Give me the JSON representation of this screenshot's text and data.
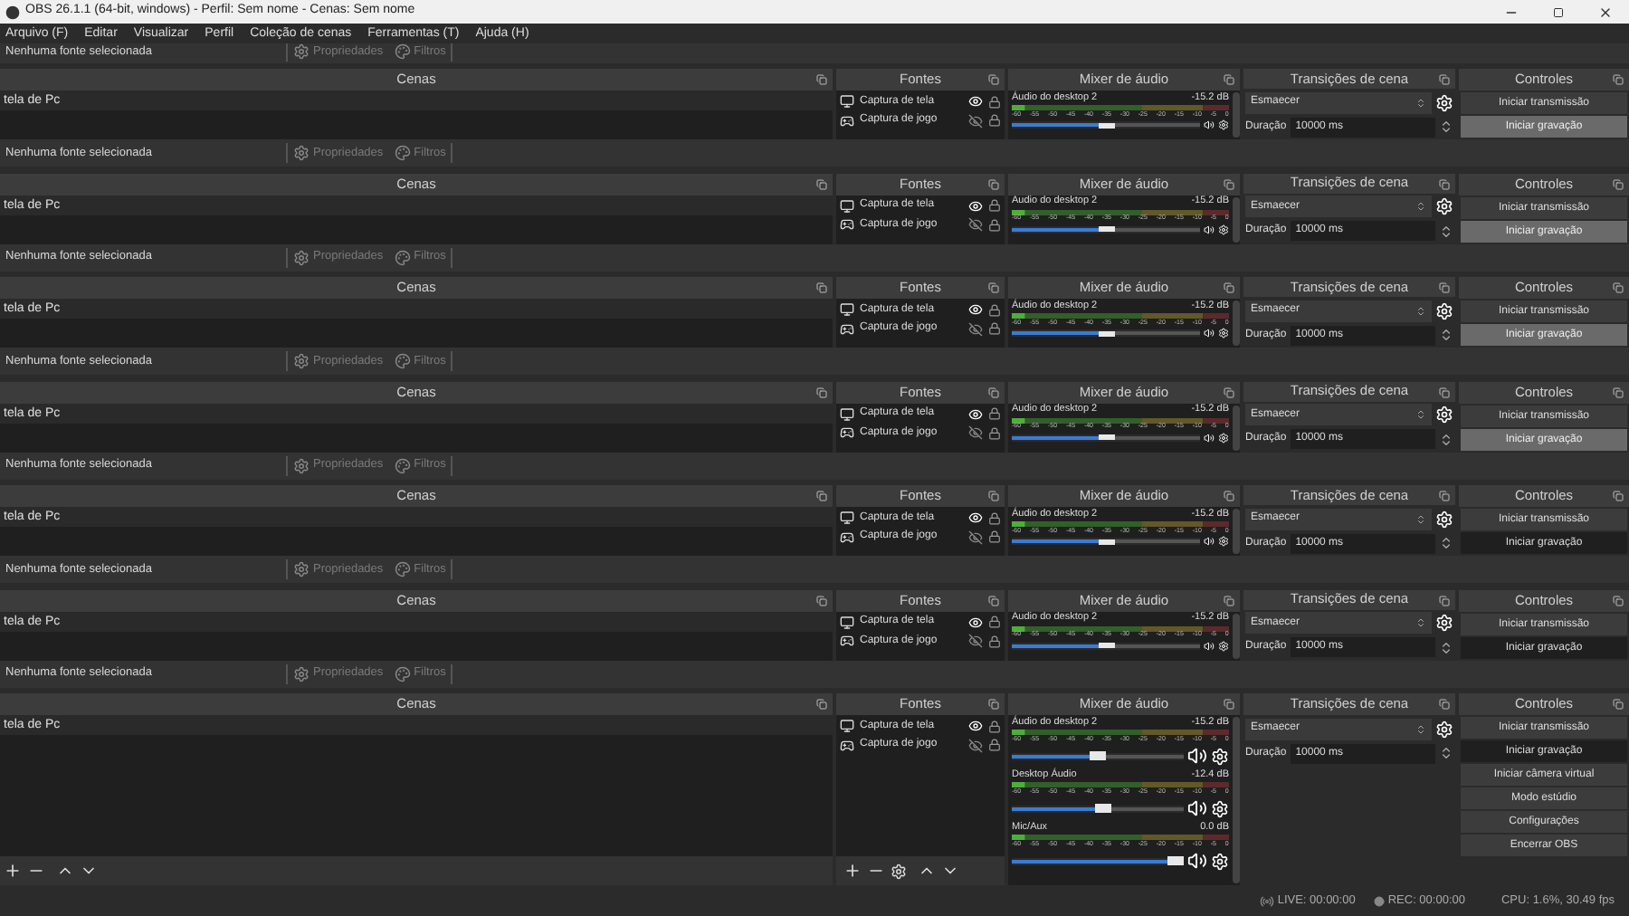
{
  "window": {
    "title": "OBS 26.1.1 (64-bit, windows) - Perfil: Sem nome - Cenas: Sem nome"
  },
  "menu": [
    "Arquivo (F)",
    "Editar",
    "Visualizar",
    "Perfil",
    "Coleção de cenas",
    "Ferramentas (T)",
    "Ajuda (H)"
  ],
  "top_strip": {
    "status": "Nenhuma fonte selecionada",
    "properties": "Propriedades",
    "filters": "Filtros"
  },
  "blocks": [
    {
      "kind": "compact",
      "scenes_title": "Cenas",
      "scenes": [
        "tela de Pc"
      ],
      "status": "Nenhuma fonte selecionada",
      "properties": "Propriedades",
      "filters": "Filtros",
      "sources_title": "Fontes",
      "sources": [
        {
          "name": "Captura de tela",
          "kind": "display",
          "visible": true
        },
        {
          "name": "Captura de jogo",
          "kind": "game",
          "visible": false
        }
      ],
      "mixer_title": "Mixer de áudio",
      "channels": [
        {
          "name": "Áudio do desktop 2",
          "reading": "-15.2 dB",
          "level": 0.55,
          "scale": [
            "-60",
            "-55",
            "-50",
            "-45",
            "-40",
            "-35",
            "-30",
            "-25",
            "-20",
            "-15",
            "-10",
            "-5",
            "0"
          ]
        }
      ],
      "transitions_title": "Transições de cena",
      "transition": "Esmaecer",
      "duration_label": "Duração",
      "duration": "10000 ms",
      "controls_title": "Controles",
      "controls": [
        {
          "label": "Iniciar transmissão",
          "highlighted": false
        },
        {
          "label": "Iniciar gravação",
          "highlighted": true
        }
      ]
    },
    {
      "kind": "compact",
      "scenes_title": "Cenas",
      "scenes": [
        "tela de Pc"
      ],
      "status": "Nenhuma fonte selecionada",
      "properties": "Propriedades",
      "filters": "Filtros",
      "sources_title": "Fontes",
      "sources": [
        {
          "name": "Captura de tela",
          "kind": "display",
          "visible": true
        },
        {
          "name": "Captura de jogo",
          "kind": "game",
          "visible": false
        }
      ],
      "mixer_title": "Mixer de áudio",
      "channels": [
        {
          "name": "Áudio do desktop 2",
          "reading": "-15.2 dB",
          "level": 0.55,
          "scale": [
            "-60",
            "-55",
            "-50",
            "-45",
            "-40",
            "-35",
            "-30",
            "-25",
            "-20",
            "-15",
            "-10",
            "-5",
            "0"
          ]
        }
      ],
      "transitions_title": "Transições de cena",
      "transition": "Esmaecer",
      "duration_label": "Duração",
      "duration": "10000 ms",
      "controls_title": "Controles",
      "controls": [
        {
          "label": "Iniciar transmissão",
          "highlighted": false
        },
        {
          "label": "Iniciar gravação",
          "highlighted": true
        }
      ]
    },
    {
      "kind": "compact",
      "scenes_title": "Cenas",
      "scenes": [
        "tela de Pc"
      ],
      "status": "Nenhuma fonte selecionada",
      "properties": "Propriedades",
      "filters": "Filtros",
      "sources_title": "Fontes",
      "sources": [
        {
          "name": "Captura de tela",
          "kind": "display",
          "visible": true
        },
        {
          "name": "Captura de jogo",
          "kind": "game",
          "visible": false
        }
      ],
      "mixer_title": "Mixer de áudio",
      "channels": [
        {
          "name": "Áudio do desktop 2",
          "reading": "-15.2 dB",
          "level": 0.55,
          "scale": [
            "-60",
            "-55",
            "-50",
            "-45",
            "-40",
            "-35",
            "-30",
            "-25",
            "-20",
            "-15",
            "-10",
            "-5",
            "0"
          ]
        }
      ],
      "transitions_title": "Transições de cena",
      "transition": "Esmaecer",
      "duration_label": "Duração",
      "duration": "10000 ms",
      "controls_title": "Controles",
      "controls": [
        {
          "label": "Iniciar transmissão",
          "highlighted": false
        },
        {
          "label": "Iniciar gravação",
          "highlighted": true
        }
      ]
    },
    {
      "kind": "compact",
      "scenes_title": "Cenas",
      "scenes": [
        "tela de Pc"
      ],
      "status": "Nenhuma fonte selecionada",
      "properties": "Propriedades",
      "filters": "Filtros",
      "sources_title": "Fontes",
      "sources": [
        {
          "name": "Captura de tela",
          "kind": "display",
          "visible": true
        },
        {
          "name": "Captura de jogo",
          "kind": "game",
          "visible": false
        }
      ],
      "mixer_title": "Mixer de áudio",
      "channels": [
        {
          "name": "Áudio do desktop 2",
          "reading": "-15.2 dB",
          "level": 0.55,
          "scale": [
            "-60",
            "-55",
            "-50",
            "-45",
            "-40",
            "-35",
            "-30",
            "-25",
            "-20",
            "-15",
            "-10",
            "-5",
            "0"
          ]
        }
      ],
      "transitions_title": "Transições de cena",
      "transition": "Esmaecer",
      "duration_label": "Duração",
      "duration": "10000 ms",
      "controls_title": "Controles",
      "controls": [
        {
          "label": "Iniciar transmissão",
          "highlighted": false
        },
        {
          "label": "Iniciar gravação",
          "highlighted": true
        }
      ]
    },
    {
      "kind": "compact",
      "scenes_title": "Cenas",
      "scenes": [
        "tela de Pc"
      ],
      "status": "Nenhuma fonte selecionada",
      "properties": "Propriedades",
      "filters": "Filtros",
      "sources_title": "Fontes",
      "sources": [
        {
          "name": "Captura de tela",
          "kind": "display",
          "visible": true
        },
        {
          "name": "Captura de jogo",
          "kind": "game",
          "visible": false
        }
      ],
      "mixer_title": "Mixer de áudio",
      "channels": [
        {
          "name": "Áudio do desktop 2",
          "reading": "-15.2 dB",
          "level": 0.55,
          "scale": [
            "-60",
            "-55",
            "-50",
            "-45",
            "-40",
            "-35",
            "-30",
            "-25",
            "-20",
            "-15",
            "-10",
            "-5",
            "0"
          ]
        }
      ],
      "transitions_title": "Transições de cena",
      "transition": "Esmaecer",
      "duration_label": "Duração",
      "duration": "10000 ms",
      "controls_title": "Controles",
      "controls": [
        {
          "label": "Iniciar transmissão",
          "highlighted": false
        },
        {
          "label": "Iniciar gravação",
          "highlighted": false
        }
      ]
    },
    {
      "kind": "compact",
      "scenes_title": "Cenas",
      "scenes": [
        "tela de Pc"
      ],
      "status": "Nenhuma fonte selecionada",
      "properties": "Propriedades",
      "filters": "Filtros",
      "sources_title": "Fontes",
      "sources": [
        {
          "name": "Captura de tela",
          "kind": "display",
          "visible": true
        },
        {
          "name": "Captura de jogo",
          "kind": "game",
          "visible": false
        }
      ],
      "mixer_title": "Mixer de áudio",
      "channels": [
        {
          "name": "Áudio do desktop 2",
          "reading": "-15.2 dB",
          "level": 0.55,
          "scale": [
            "-60",
            "-55",
            "-50",
            "-45",
            "-40",
            "-35",
            "-30",
            "-25",
            "-20",
            "-15",
            "-10",
            "-5",
            "0"
          ]
        }
      ],
      "transitions_title": "Transições de cena",
      "transition": "Esmaecer",
      "duration_label": "Duração",
      "duration": "10000 ms",
      "controls_title": "Controles",
      "controls": [
        {
          "label": "Iniciar transmissão",
          "highlighted": false
        },
        {
          "label": "Iniciar gravação",
          "highlighted": false
        }
      ]
    },
    {
      "kind": "full",
      "scenes_title": "Cenas",
      "scenes": [
        "tela de Pc"
      ],
      "sources_title": "Fontes",
      "sources": [
        {
          "name": "Captura de tela",
          "kind": "display",
          "visible": true
        },
        {
          "name": "Captura de jogo",
          "kind": "game",
          "visible": false
        }
      ],
      "mixer_title": "Mixer de áudio",
      "channels": [
        {
          "name": "Áudio do desktop 2",
          "reading": "-15.2 dB",
          "level": 0.55,
          "scale": [
            "-60",
            "-55",
            "-50",
            "-45",
            "-40",
            "-35",
            "-30",
            "-25",
            "-20",
            "-15",
            "-10",
            "-5",
            "0"
          ]
        },
        {
          "name": "Desktop Áudio",
          "reading": "-12.4 dB",
          "level": 0.58,
          "scale": [
            "-60",
            "-55",
            "-50",
            "-45",
            "-40",
            "-35",
            "-30",
            "-25",
            "-20",
            "-15",
            "-10",
            "-5",
            "0"
          ]
        },
        {
          "name": "Mic/Aux",
          "reading": "0.0 dB",
          "level": 1,
          "scale": [
            "-60",
            "-55",
            "-50",
            "-45",
            "-40",
            "-35",
            "-30",
            "-25",
            "-20",
            "-15",
            "-10",
            "-5",
            "0"
          ]
        }
      ],
      "transitions_title": "Transições de cena",
      "transition": "Esmaecer",
      "duration_label": "Duração",
      "duration": "10000 ms",
      "controls_title": "Controles",
      "controls": [
        {
          "label": "Iniciar transmissão",
          "highlighted": false
        },
        {
          "label": "Iniciar gravação",
          "highlighted": false
        },
        {
          "label": "Iniciar câmera virtual",
          "highlighted": false
        },
        {
          "label": "Modo estúdio",
          "highlighted": false
        },
        {
          "label": "Configurações",
          "highlighted": false
        },
        {
          "label": "Encerrar OBS",
          "highlighted": false
        }
      ]
    }
  ],
  "status_bar": {
    "live": "LIVE: 00:00:00",
    "rec": "REC: 00:00:00",
    "cpu": "CPU: 1.6%, 30.49 fps"
  }
}
